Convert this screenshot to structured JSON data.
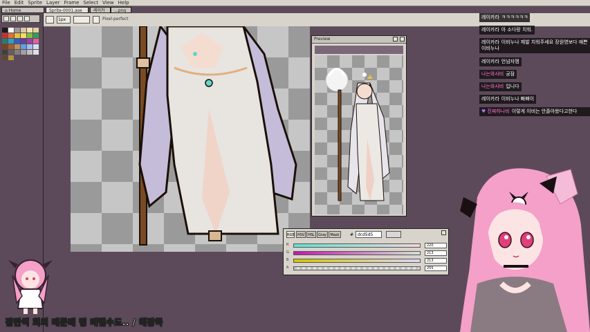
{
  "menu": [
    "File",
    "Edit",
    "Sprite",
    "Layer",
    "Frame",
    "Select",
    "View",
    "Help"
  ],
  "tabs": {
    "home": "Home",
    "sprite": "Sprite-0001.ase",
    "sprite_close": "×",
    "third": "레이카",
    "fourth": "...png"
  },
  "toolbar": {
    "brush_size": "1px",
    "pixel_perfect": "Pixel-perfect"
  },
  "preview": {
    "title": "Preview"
  },
  "color_panel": {
    "tabs": [
      "RGB",
      "HSV",
      "HSL",
      "Gray",
      "Mask"
    ],
    "hash": "#",
    "hex": "dcd5d5",
    "channels": [
      {
        "label": "R",
        "value": "220",
        "gradient": "#5ee4d6, #f4d4dc"
      },
      {
        "label": "G",
        "value": "213",
        "gradient": "#c414b4, #d4e2d4"
      },
      {
        "label": "B",
        "value": "213",
        "gradient": "#d4c400, #dcd5f5"
      },
      {
        "label": "A",
        "value": "255",
        "gradient": "#c0c0c0, #dcd5d5"
      }
    ]
  },
  "chat": [
    {
      "nick": "레이카라",
      "text": "ㅋㅋㅋㅋㅋㅋ",
      "nick_color": "#ffffff"
    },
    {
      "nick": "레이카라",
      "text": "아 소다랑 치워.",
      "nick_color": "#ffffff"
    },
    {
      "nick": "레이카라",
      "text": "이비누나 제발 치워주세요 장원영보다 예쁜 이비누나",
      "nick_color": "#ffffff"
    },
    {
      "nick": "레이카라",
      "text": "언넘자맴",
      "nick_color": "#ffffff"
    },
    {
      "nick": "나는와사비",
      "text": "궁잠",
      "nick_color": "#ff7ad1"
    },
    {
      "nick": "나는와사비",
      "text": "입니다",
      "nick_color": "#ff7ad1"
    },
    {
      "nick": "레이카라",
      "text": "이비누나 빠빠이",
      "nick_color": "#ffffff"
    },
    {
      "nick": "진짜하나비",
      "text": "이렇게 이비는 안졸아왔다고한다",
      "nick_color": "#ff7ad1"
    }
  ],
  "subtitle": "잠깐씩 회의 때문에 멍 때릴수도.. / 해장죽",
  "colors": {
    "app_bg": "#5c4a5a",
    "panel": "#d8d4cc",
    "chat_bg": "#141012",
    "hair_pink": "#f4a0c8"
  }
}
